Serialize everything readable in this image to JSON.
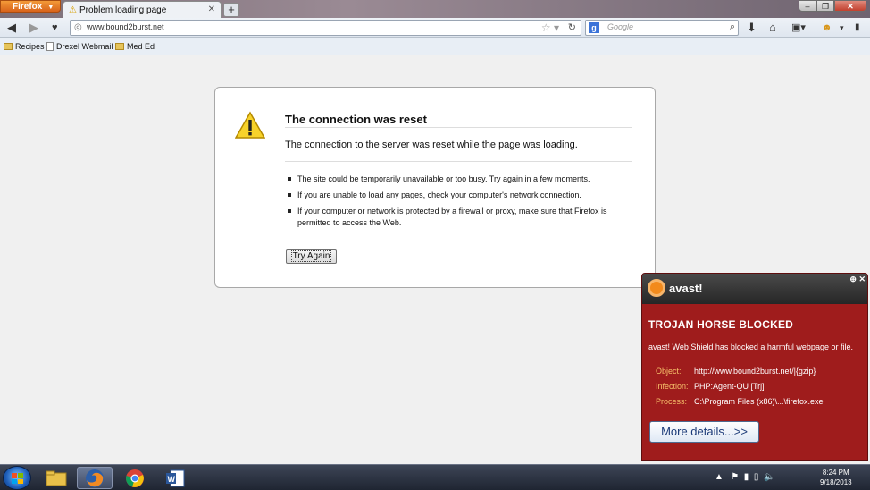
{
  "browser": {
    "menu_label": "Firefox",
    "tab_title": "Problem loading page",
    "new_tab_label": "+",
    "url": "www.bound2burst.net",
    "search_engine": "Google",
    "search_placeholder": "Google",
    "bookmarks": [
      "Recipes",
      "Drexel Webmail",
      "Med Ed"
    ]
  },
  "error_page": {
    "title": "The connection was reset",
    "description": "The connection to the server was reset while the page was loading.",
    "bullets": [
      "The site could be temporarily unavailable or too busy. Try again in a few moments.",
      "If you are unable to load any pages, check your computer's network connection.",
      "If your computer or network is protected by a firewall or proxy, make sure that Firefox is permitted to access the Web."
    ],
    "button_label": "Try Again"
  },
  "avast_popup": {
    "brand": "avast!",
    "heading": "TROJAN HORSE BLOCKED",
    "message": "avast! Web Shield has blocked a harmful webpage or file.",
    "rows": [
      {
        "key": "Object:",
        "value": "http://www.bound2burst.net/|{gzip}"
      },
      {
        "key": "Infection:",
        "value": "PHP:Agent-QU [Trj]"
      },
      {
        "key": "Process:",
        "value": "C:\\Program Files (x86)\\...\\firefox.exe"
      }
    ],
    "button_label": "More details...>>",
    "colors": {
      "panel": "#9f1c1c",
      "header": "#2f2f2f",
      "key_text": "#f6c06a"
    }
  },
  "taskbar": {
    "time": "8:24 PM",
    "date": "9/18/2013",
    "apps": [
      "windows-explorer",
      "firefox",
      "chrome",
      "word"
    ]
  }
}
